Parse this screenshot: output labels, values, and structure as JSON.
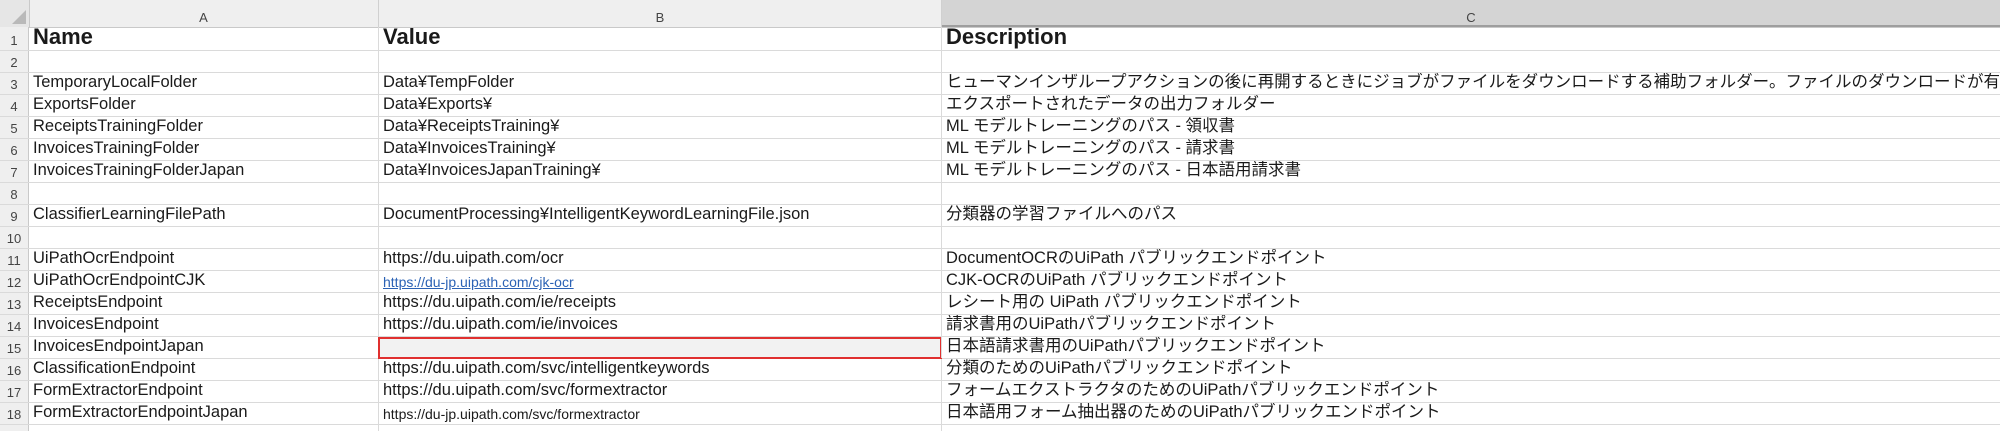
{
  "columns": [
    "A",
    "B",
    "C"
  ],
  "rows": [
    {
      "num": "1",
      "a": "Name",
      "b": "Value",
      "c": "Description"
    },
    {
      "num": "2",
      "a": "",
      "b": "",
      "c": ""
    },
    {
      "num": "3",
      "a": "TemporaryLocalFolder",
      "b": "Data¥TempFolder",
      "c": "ヒューマンインザループアクションの後に再開するときにジョブがファイルをダウンロードする補助フォルダー。ファイルのダウンロードが有効になっている場合にのみ使用"
    },
    {
      "num": "4",
      "a": "ExportsFolder",
      "b": "Data¥Exports¥",
      "c": "エクスポートされたデータの出力フォルダー"
    },
    {
      "num": "5",
      "a": "ReceiptsTrainingFolder",
      "b": "Data¥ReceiptsTraining¥",
      "c": "ML モデルトレーニングのパス - 領収書"
    },
    {
      "num": "6",
      "a": "InvoicesTrainingFolder",
      "b": "Data¥InvoicesTraining¥",
      "c": "ML モデルトレーニングのパス - 請求書"
    },
    {
      "num": "7",
      "a": "InvoicesTrainingFolderJapan",
      "b": "Data¥InvoicesJapanTraining¥",
      "c": "ML モデルトレーニングのパス - 日本語用請求書"
    },
    {
      "num": "8",
      "a": "",
      "b": "",
      "c": ""
    },
    {
      "num": "9",
      "a": "ClassifierLearningFilePath",
      "b": "DocumentProcessing¥IntelligentKeywordLearningFile.json",
      "c": "分類器の学習ファイルへのパス"
    },
    {
      "num": "10",
      "a": "",
      "b": "",
      "c": ""
    },
    {
      "num": "11",
      "a": "UiPathOcrEndpoint",
      "b": "https://du.uipath.com/ocr",
      "c": "DocumentOCRのUiPath パブリックエンドポイント"
    },
    {
      "num": "12",
      "a": "UiPathOcrEndpointCJK",
      "b": "https://du-jp.uipath.com/cjk-ocr",
      "c": "CJK-OCRのUiPath パブリックエンドポイント"
    },
    {
      "num": "13",
      "a": "ReceiptsEndpoint",
      "b": "https://du.uipath.com/ie/receipts",
      "c": "レシート用の UiPath パブリックエンドポイント"
    },
    {
      "num": "14",
      "a": "InvoicesEndpoint",
      "b": "https://du.uipath.com/ie/invoices",
      "c": "請求書用のUiPathパブリックエンドポイント"
    },
    {
      "num": "15",
      "a": "InvoicesEndpointJapan",
      "b": "",
      "c": "日本語請求書用のUiPathパブリックエンドポイント"
    },
    {
      "num": "16",
      "a": "ClassificationEndpoint",
      "b": "https://du.uipath.com/svc/intelligentkeywords",
      "c": "分類のためのUiPathパブリックエンドポイント"
    },
    {
      "num": "17",
      "a": "FormExtractorEndpoint",
      "b": "https://du.uipath.com/svc/formextractor",
      "c": "フォームエクストラクタのためのUiPathパブリックエンドポイント"
    },
    {
      "num": "18",
      "a": "FormExtractorEndpointJapan",
      "b": "https://du-jp.uipath.com/svc/formextractor",
      "c": "日本語用フォーム抽出器のためのUiPathパブリックエンドポイント"
    }
  ],
  "selected_cell": "B15"
}
